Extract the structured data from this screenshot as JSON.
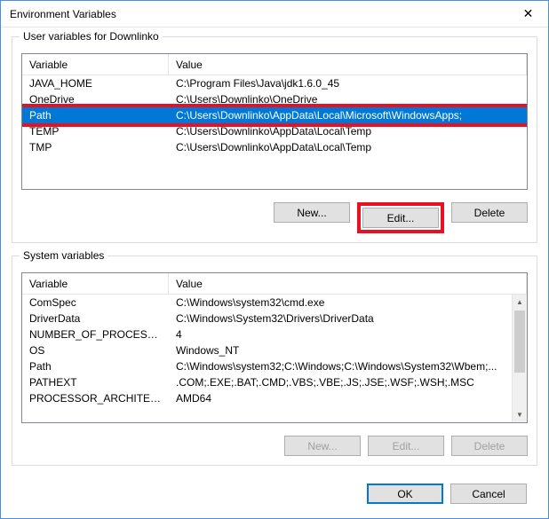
{
  "window": {
    "title": "Environment Variables"
  },
  "user_group": {
    "legend": "User variables for Downlinko",
    "header_var": "Variable",
    "header_val": "Value",
    "rows": [
      {
        "name": "JAVA_HOME",
        "value": "C:\\Program Files\\Java\\jdk1.6.0_45"
      },
      {
        "name": "OneDrive",
        "value": "C:\\Users\\Downlinko\\OneDrive"
      },
      {
        "name": "Path",
        "value": "C:\\Users\\Downlinko\\AppData\\Local\\Microsoft\\WindowsApps;"
      },
      {
        "name": "TEMP",
        "value": "C:\\Users\\Downlinko\\AppData\\Local\\Temp"
      },
      {
        "name": "TMP",
        "value": "C:\\Users\\Downlinko\\AppData\\Local\\Temp"
      }
    ],
    "selected_index": 2,
    "buttons": {
      "new": "New...",
      "edit": "Edit...",
      "delete": "Delete"
    }
  },
  "system_group": {
    "legend": "System variables",
    "header_var": "Variable",
    "header_val": "Value",
    "rows": [
      {
        "name": "ComSpec",
        "value": "C:\\Windows\\system32\\cmd.exe"
      },
      {
        "name": "DriverData",
        "value": "C:\\Windows\\System32\\Drivers\\DriverData"
      },
      {
        "name": "NUMBER_OF_PROCESSORS",
        "value": "4"
      },
      {
        "name": "OS",
        "value": "Windows_NT"
      },
      {
        "name": "Path",
        "value": "C:\\Windows\\system32;C:\\Windows;C:\\Windows\\System32\\Wbem;..."
      },
      {
        "name": "PATHEXT",
        "value": ".COM;.EXE;.BAT;.CMD;.VBS;.VBE;.JS;.JSE;.WSF;.WSH;.MSC"
      },
      {
        "name": "PROCESSOR_ARCHITECTURE",
        "value": "AMD64"
      }
    ],
    "buttons": {
      "new": "New...",
      "edit": "Edit...",
      "delete": "Delete"
    }
  },
  "dialog_buttons": {
    "ok": "OK",
    "cancel": "Cancel"
  },
  "highlight": {
    "row": true,
    "edit_button": true,
    "color": "#e81123"
  }
}
